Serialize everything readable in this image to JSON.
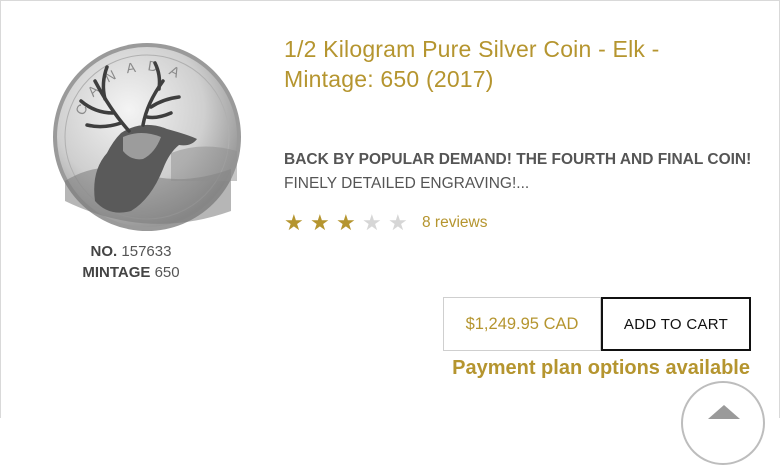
{
  "product": {
    "title": "1/2 Kilogram Pure Silver Coin - Elk - Mintage: 650 (2017)",
    "coin_inscription": "CANADA",
    "description_bold": "BACK BY POPULAR DEMAND! THE FOURTH AND FINAL COIN!",
    "description_rest": " FINELY DETAILED ENGRAVING!...",
    "no_label": "NO.",
    "no_value": "157633",
    "mintage_label": "MINTAGE",
    "mintage_value": "650",
    "rating": 3,
    "rating_max": 5,
    "reviews_text": "8 reviews",
    "price": "$1,249.95 CAD",
    "add_to_cart": "ADD TO CART",
    "payment_plan": "Payment plan options available"
  },
  "colors": {
    "accent": "#b5952f",
    "star_off": "#d6d6d6",
    "border": "#d9d9d9"
  },
  "icons": [
    "star-icon",
    "scroll-to-top-icon"
  ]
}
